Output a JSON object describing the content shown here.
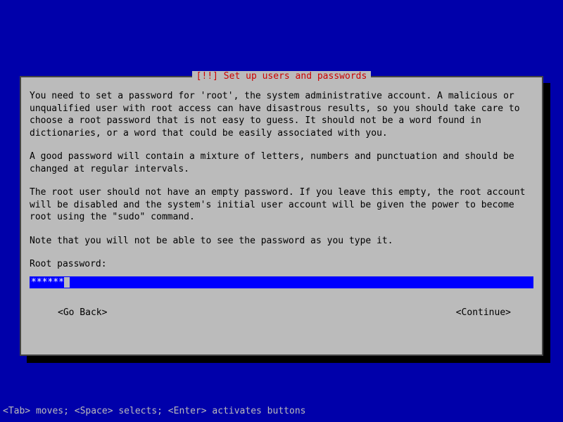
{
  "dialog": {
    "title": "[!!] Set up users and passwords",
    "paragraph1": "You need to set a password for 'root', the system administrative account. A malicious or unqualified user with root access can have disastrous results, so you should take care to choose a root password that is not easy to guess. It should not be a word found in dictionaries, or a word that could be easily associated with you.",
    "paragraph2": "A good password will contain a mixture of letters, numbers and punctuation and should be changed at regular intervals.",
    "paragraph3": "The root user should not have an empty password. If you leave this empty, the root account will be disabled and the system's initial user account will be given the power to become root using the \"sudo\" command.",
    "paragraph4": "Note that you will not be able to see the password as you type it.",
    "prompt_label": "Root password:",
    "password_masked": "******",
    "buttons": {
      "back": "<Go Back>",
      "continue": "<Continue>"
    }
  },
  "footer_hint": "<Tab> moves; <Space> selects; <Enter> activates buttons"
}
